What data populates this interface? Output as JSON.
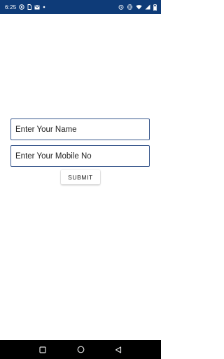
{
  "status_bar": {
    "time": "6:25",
    "background": "#0e3b78",
    "left_icons": [
      "notification-icon",
      "sim-icon",
      "mail-icon",
      "dot-icon"
    ],
    "right_icons": [
      "alarm-icon",
      "vibrate-icon",
      "wifi-icon",
      "signal-icon",
      "battery-icon"
    ]
  },
  "form": {
    "name_placeholder": "Enter Your Name",
    "mobile_placeholder": "Enter Your Mobile No",
    "submit_label": "SUBMIT",
    "border_color": "#3d5b8f"
  },
  "nav_bar": {
    "buttons": [
      "recents-icon",
      "home-icon",
      "back-icon"
    ]
  }
}
